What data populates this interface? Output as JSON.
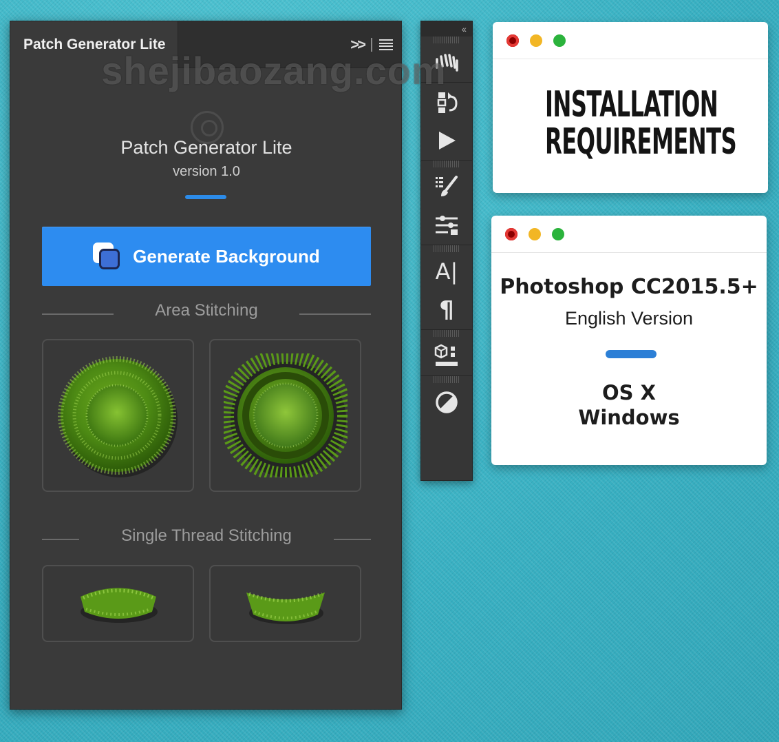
{
  "panel": {
    "tab_label": "Patch Generator Lite",
    "collapse_glyph": ">>",
    "watermark": "shejibaozang.com",
    "plugin_title": "Patch Generator Lite",
    "plugin_version": "version 1.0",
    "accent_color": "#2c8be8",
    "generate_button_label": "Generate Background",
    "sections": [
      {
        "label": "Area Stitching",
        "items": [
          "round-patch-stitch",
          "sunburst-patch-stitch"
        ]
      },
      {
        "label": "Single Thread Stitching",
        "items": [
          "thread-stitch-small",
          "thread-stitch-arc"
        ]
      }
    ]
  },
  "toolbar": {
    "collapse_glyph": "‹‹",
    "tools": [
      {
        "name": "fan-brush-icon"
      },
      {
        "name": "history-icon"
      },
      {
        "name": "play-icon"
      },
      {
        "name": "brush-presets-icon"
      },
      {
        "name": "adjustments-icon"
      },
      {
        "name": "character-icon",
        "glyph": "A|"
      },
      {
        "name": "paragraph-icon",
        "glyph": "¶"
      },
      {
        "name": "3d-icon"
      },
      {
        "name": "contrast-icon"
      }
    ]
  },
  "requirements_window": {
    "title_line1": "INSTALLATION",
    "title_line2": "REQUIREMENTS"
  },
  "info_window": {
    "app": "Photoshop CC2015.5+",
    "language": "English Version",
    "os1": "OS X",
    "os2": "Windows",
    "accent_color": "#2c7fd6"
  }
}
